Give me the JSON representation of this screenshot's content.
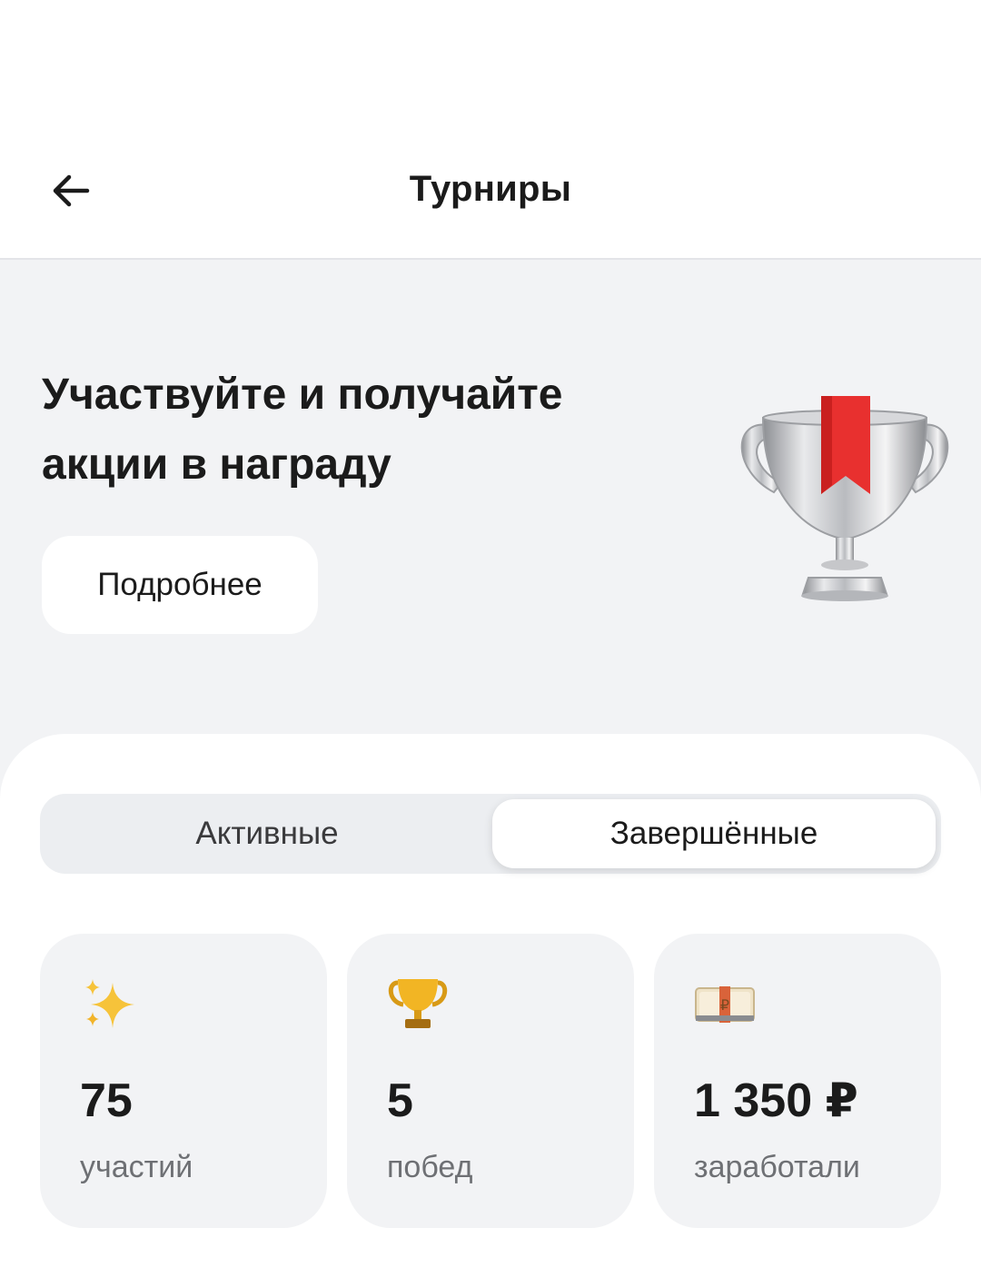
{
  "header": {
    "back_icon": "arrow-left-icon",
    "title": "Турниры"
  },
  "promo": {
    "heading": "Участвуйте и получайте акции в награду",
    "more_button": "Подробнее",
    "image_icon": "silver-trophy-ribbon-icon"
  },
  "tabs": [
    {
      "label": "Активные",
      "selected": false
    },
    {
      "label": "Завершённые",
      "selected": true
    }
  ],
  "stats": [
    {
      "icon": "sparkles-icon",
      "value": "75",
      "label": "участий"
    },
    {
      "icon": "trophy-icon",
      "value": "5",
      "label": "побед"
    },
    {
      "icon": "money-bag-icon",
      "value": "1 350 ₽",
      "label": "заработали"
    }
  ],
  "colors": {
    "background": "#f2f3f5",
    "card": "#ffffff",
    "ribbon": "#e8302f",
    "muted_text": "#6e7074"
  }
}
